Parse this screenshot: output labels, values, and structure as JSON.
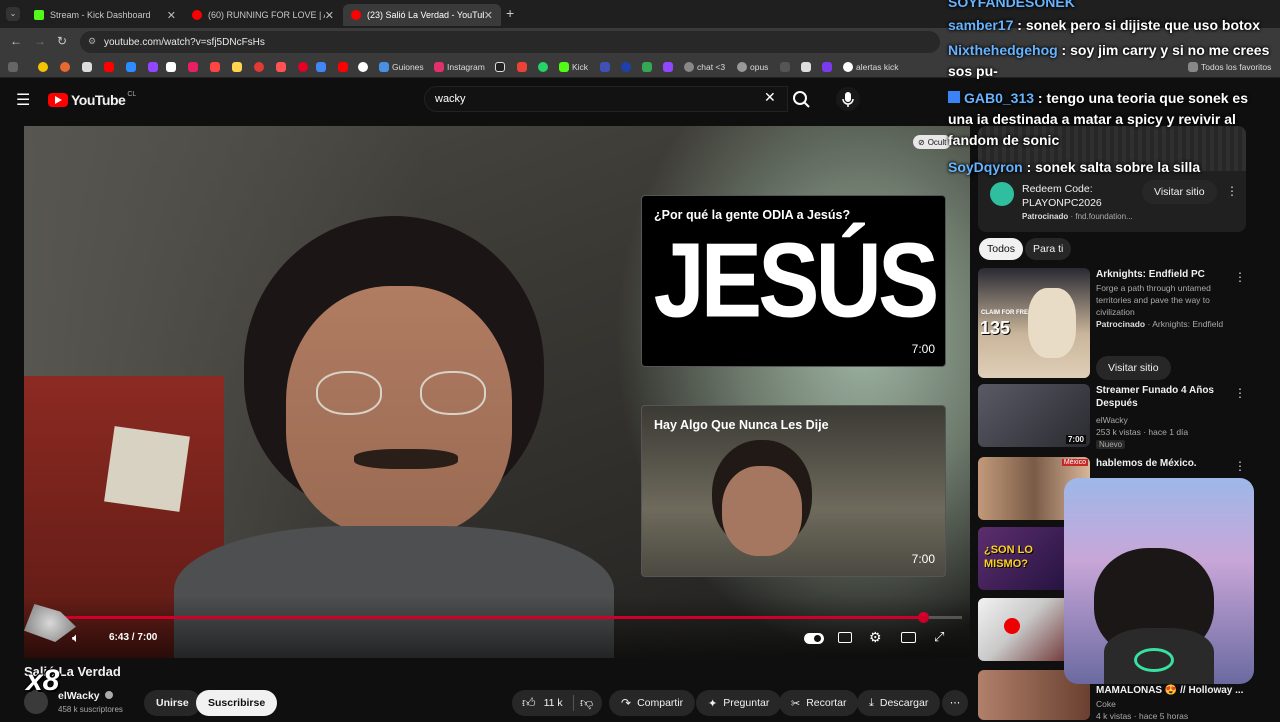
{
  "tabs": [
    {
      "title": "Stream - Kick Dashboard",
      "color": "#53fc18"
    },
    {
      "title": "(60) RUNNING FOR LOVE | AM",
      "color": "#ff0000"
    },
    {
      "title": "(23) Salió La Verdad - YouTube",
      "color": "#ff0000"
    }
  ],
  "address": {
    "url": "youtube.com/watch?v=sfj5DNcFsHs"
  },
  "bookmarks": [
    {
      "label": "Guiones"
    },
    {
      "label": "Instagram"
    },
    {
      "label": "Kick"
    },
    {
      "label": "chat <3"
    },
    {
      "label": "opus"
    },
    {
      "label": "alertas kick"
    },
    {
      "label": "Todos los favoritos"
    }
  ],
  "youtube": {
    "logo": "YouTube",
    "region": "CL",
    "search_value": "wacky"
  },
  "player": {
    "time": "6:43 / 7:00",
    "progress": 0.958,
    "hide_label": "Ocult",
    "end_cards": [
      {
        "title": "¿Por qué la gente ODIA a Jesús?",
        "thumb_text": "JESÚS",
        "duration": "7:00"
      },
      {
        "title": "Hay Algo Que Nunca Les Dije",
        "duration": "7:00"
      }
    ]
  },
  "video": {
    "title": "Salió La Verdad",
    "channel": "elWacky",
    "subscribers": "458 k suscriptores",
    "join": "Unirse",
    "subscribe": "Suscribirse",
    "likes": "11 k",
    "share": "Compartir",
    "ask": "Preguntar",
    "clip": "Recortar",
    "download": "Descargar"
  },
  "overlay": {
    "badge": "x8"
  },
  "chat": [
    {
      "user": "SOYFANDESONEK",
      "message": ""
    },
    {
      "user": "samber17",
      "message": "sonek pero si dijiste que uso botox"
    },
    {
      "user": "Nixthehedgehog",
      "message": "soy jim carry y si no me crees sos pu-"
    },
    {
      "user": "GAB0_313",
      "message": "tengo una teoria que sonek es una ia destinada a matar a spicy y revivir al fandom de sonic"
    },
    {
      "user": "SoyDqyron",
      "message": "sonek salta sobre la silla"
    }
  ],
  "ad": {
    "title": "Redeem Code: PLAYONPC2026",
    "meta_bold": "Patrocinado",
    "meta": "fnd.foundation...",
    "button": "Visitar sitio"
  },
  "filters": [
    "Todos",
    "Para ti"
  ],
  "recommendations": [
    {
      "title": "Arknights: Endfield PC",
      "desc": "Forge a path through untamed territories and pave the way to civilization",
      "sponsor": "Patrocinado",
      "channel": "Arknights: Endfield",
      "button": "Visitar sitio",
      "thumb_text": "135",
      "thumb_label": "CLAIM FOR FREE"
    },
    {
      "title": "Streamer Funado 4 Años Después",
      "channel": "elWacky",
      "views": "253 k vistas · hace 1 día",
      "badge": "Nuevo",
      "duration": "7:00"
    },
    {
      "title": "hablemos de México.",
      "badge": "México"
    },
    {
      "title": "",
      "thumb_text": "¿SON LO MISMO?"
    },
    {
      "title": ""
    },
    {
      "title": "MAMALONAS 😍 // Holloway ...",
      "channel": "Coke",
      "views": "4 k vistas · hace 5 horas"
    }
  ]
}
